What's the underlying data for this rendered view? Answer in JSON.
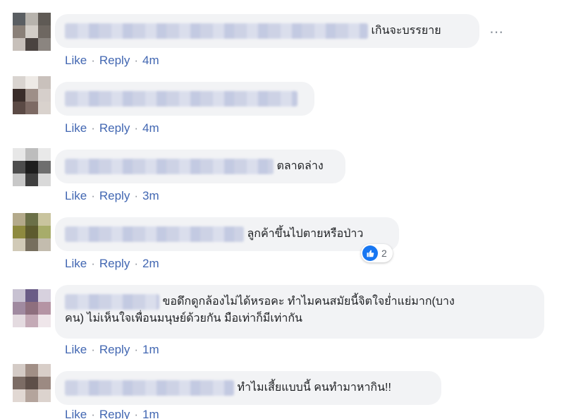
{
  "actions": {
    "like": "Like",
    "reply": "Reply",
    "sep": "·"
  },
  "comments": [
    {
      "text": "เกินจะบรรยาย",
      "time": "4m",
      "avatar": [
        "#5a5e62",
        "#b7b3ad",
        "#5f5a55",
        "#8a8078",
        "#d3cec8",
        "#6e6761",
        "#c7c0ba",
        "#4a4340",
        "#8b8580"
      ]
    },
    {
      "text": "",
      "time": "4m",
      "avatar": [
        "#d9d4d0",
        "#eeeae6",
        "#c9c1bc",
        "#3a2d2a",
        "#9e8f88",
        "#d6cfcb",
        "#5b4a45",
        "#7d6a64",
        "#d9d2cd"
      ]
    },
    {
      "text": "ตลาดล่าง",
      "time": "3m",
      "avatar": [
        "#e7e7e7",
        "#bdbdbd",
        "#e9e9e9",
        "#4d4d4d",
        "#1d1d1d",
        "#6e6e6e",
        "#c8c8c8",
        "#3f3f3f",
        "#d9d9d9"
      ]
    },
    {
      "text": "ลูกค้าขึ้นไปตายหรือป่าว",
      "time": "2m",
      "avatar": [
        "#b4aa8b",
        "#6b7048",
        "#c9c49e",
        "#8e8a3f",
        "#5d5b2e",
        "#a7ac6a",
        "#d1cab7",
        "#776f5e",
        "#c3bcae"
      ]
    },
    {
      "text": "ขอดึกดูกล้องไม่ได้หรอคะ ทำไมคนสมัยนี้จิตใจย่ำแย่มาก(บาง",
      "text2": "คน) ไม่เห็นใจเพื่อนมนุษย์ด้วยกัน มือเท่าก็มีเท่ากัน",
      "time": "1m",
      "avatar": [
        "#c8c2d2",
        "#6a5c86",
        "#d7d1de",
        "#a08aa0",
        "#8e6f7e",
        "#b594a4",
        "#e4dbe0",
        "#c4aab6",
        "#efe6ea"
      ]
    },
    {
      "text": "ทำไมเสี้ยแบบนี้ คนทำมาหากิน!!",
      "time": "1m",
      "avatar": [
        "#d4cbc6",
        "#a18f86",
        "#d8cec8",
        "#7c6c65",
        "#5e4f49",
        "#9c8a82",
        "#e1d8d3",
        "#b4a49c",
        "#dcd3ce"
      ]
    }
  ],
  "reaction": {
    "count": "2"
  },
  "more": "⋯"
}
